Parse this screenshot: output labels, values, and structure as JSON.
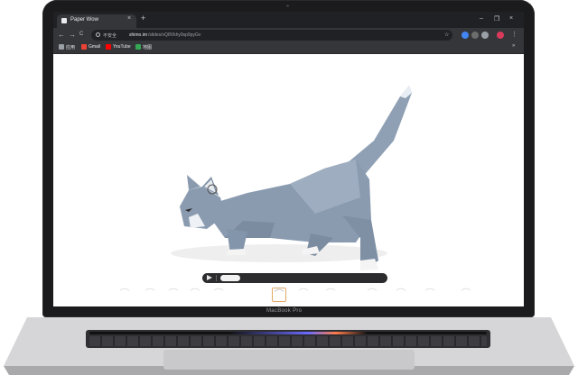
{
  "device_label": "MacBook Pro",
  "browser": {
    "tab": {
      "title": "Paper Wow",
      "close": "×"
    },
    "new_tab": "+",
    "window_controls": {
      "minimize": "–",
      "maximize": "❐",
      "close": "×"
    },
    "nav": {
      "back": "←",
      "forward": "→",
      "reload": "C"
    },
    "address": {
      "security": "不安全",
      "host": "shimo.im",
      "path": "/slides/vQ8Vkhy9sp9pyGv"
    },
    "bookmarks": [
      "应用",
      "Gmail",
      "YouTube",
      "地图"
    ]
  },
  "colors": {
    "laptop_frame": "#1b1b1d",
    "chrome_dark": "#202124",
    "toolbar": "#35363a",
    "cat_body": "#8a9bb0",
    "player_bg": "#2c2c2e",
    "selected_thumb_border": "#e2a865"
  },
  "player": {
    "progress": 0.12
  },
  "thumbnails": [
    "cat-pose-1",
    "cat-pose-2",
    "cat-pose-3",
    "cat-pose-4",
    "cat-pose-5",
    "cat-pose-6",
    "cat-pose-7",
    "cat-pose-8",
    "cat-pose-9",
    "cat-pose-10",
    "cat-pose-11",
    "cat-pose-12"
  ],
  "selected_thumbnail_index": 5
}
